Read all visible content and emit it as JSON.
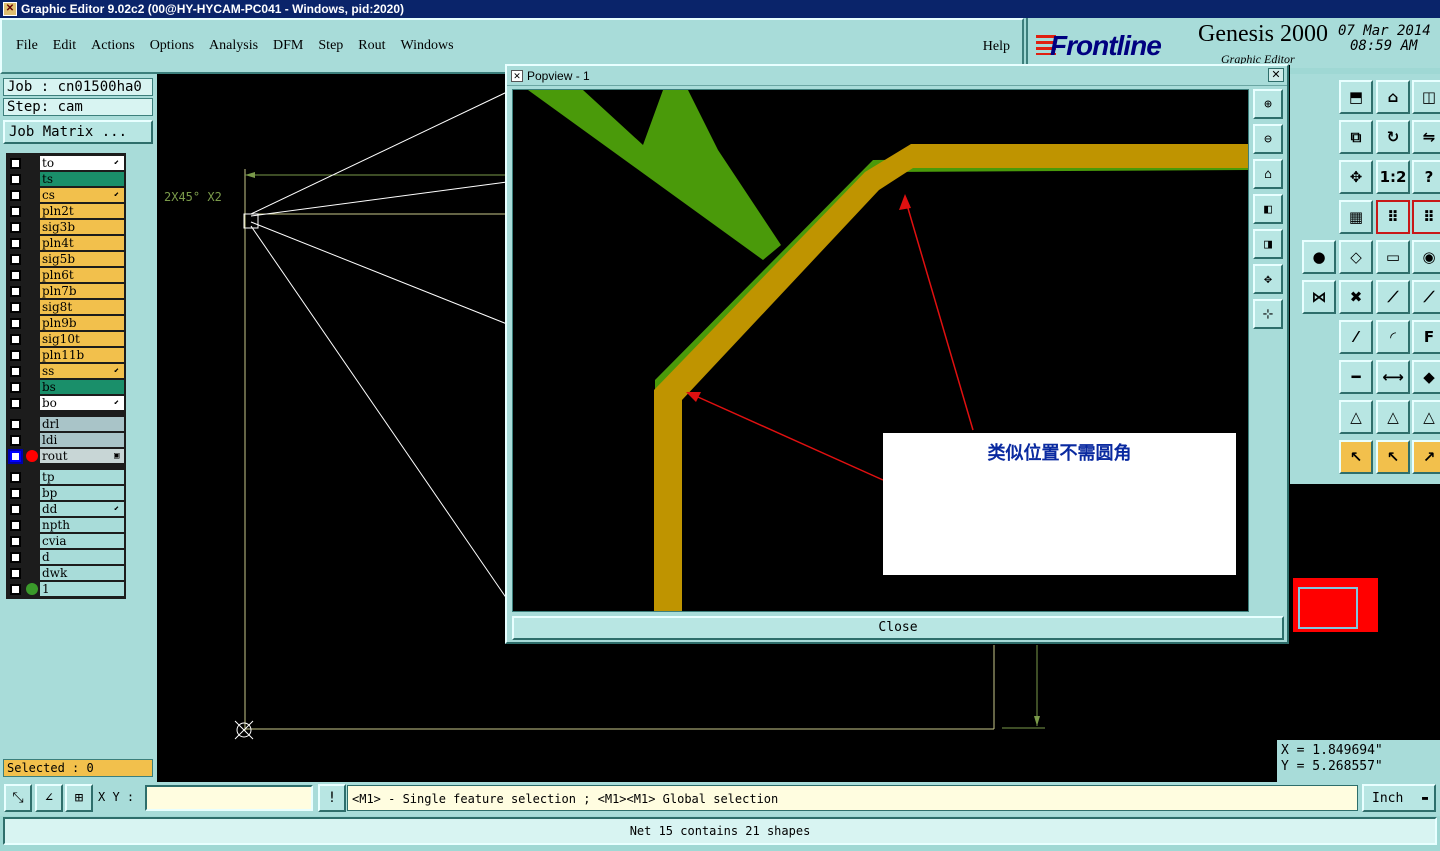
{
  "window": {
    "title": "Graphic Editor 9.02c2 (00@HY-HYCAM-PC041 - Windows, pid:2020)"
  },
  "menu": {
    "items": [
      "File",
      "Edit",
      "Actions",
      "Options",
      "Analysis",
      "DFM",
      "Step",
      "Rout",
      "Windows"
    ],
    "help": "Help"
  },
  "brand": {
    "logo": "Frontline",
    "product": "Genesis 2000",
    "subtitle": "Graphic Editor",
    "date": "07 Mar 2014",
    "time": "08:59 AM"
  },
  "job": {
    "job_label": "Job : cn01500ha0",
    "step_label": "Step: cam",
    "matrix_button": "Job Matrix ..."
  },
  "layers": {
    "group1": [
      {
        "name": "to",
        "color": "#ffffff",
        "flag": true
      },
      {
        "name": "ts",
        "color": "#1a8f6a",
        "flag": false
      },
      {
        "name": "cs",
        "color": "#f2c04c",
        "flag": true
      },
      {
        "name": "pln2t",
        "color": "#f2c04c",
        "flag": false
      },
      {
        "name": "sig3b",
        "color": "#f2c04c",
        "flag": false
      },
      {
        "name": "pln4t",
        "color": "#f2c04c",
        "flag": false
      },
      {
        "name": "sig5b",
        "color": "#f2c04c",
        "flag": false
      },
      {
        "name": "pln6t",
        "color": "#f2c04c",
        "flag": false
      },
      {
        "name": "pln7b",
        "color": "#f2c04c",
        "flag": false
      },
      {
        "name": "sig8t",
        "color": "#f2c04c",
        "flag": false
      },
      {
        "name": "pln9b",
        "color": "#f2c04c",
        "flag": false
      },
      {
        "name": "sig10t",
        "color": "#f2c04c",
        "flag": false
      },
      {
        "name": "pln11b",
        "color": "#f2c04c",
        "flag": false
      },
      {
        "name": "ss",
        "color": "#f2c04c",
        "flag": true
      },
      {
        "name": "bs",
        "color": "#1a8f6a",
        "flag": false
      },
      {
        "name": "bo",
        "color": "#ffffff",
        "flag": true
      }
    ],
    "group2": [
      {
        "name": "drl",
        "color": "#a9c4c8",
        "flag": false
      },
      {
        "name": "ldi",
        "color": "#a9c4c8",
        "flag": false
      },
      {
        "name": "rout",
        "color": "#c8d6d6",
        "flag": false,
        "dot": "#ff0000",
        "active": true
      }
    ],
    "group3": [
      {
        "name": "tp",
        "color": "#a8dcd9",
        "flag": false
      },
      {
        "name": "bp",
        "color": "#a8dcd9",
        "flag": false
      },
      {
        "name": "dd",
        "color": "#a8dcd9",
        "flag": true
      },
      {
        "name": "npth",
        "color": "#a8dcd9",
        "flag": false
      },
      {
        "name": "cvia",
        "color": "#a8dcd9",
        "flag": false
      },
      {
        "name": "d",
        "color": "#a8dcd9",
        "flag": false
      },
      {
        "name": "dwk",
        "color": "#a8dcd9",
        "flag": false
      },
      {
        "name": "1",
        "color": "#a8dcd9",
        "flag": false,
        "dot": "#3a9a2a"
      }
    ]
  },
  "selection": {
    "label": "Selected : 0"
  },
  "canvas": {
    "dimension_label": "2X45° X2"
  },
  "coords": {
    "x": "X = 1.849694\"",
    "y": "Y = 5.268557\""
  },
  "bottom": {
    "xy_label": "X Y :",
    "xy_value": "",
    "hint": "<M1> - Single feature selection ; <M1><M1> Global selection",
    "units": "Inch",
    "status": "Net 15 contains 21 shapes"
  },
  "popview": {
    "title": "Popview - 1",
    "close_label": "Close",
    "annotation": "类似位置不需圆角"
  }
}
